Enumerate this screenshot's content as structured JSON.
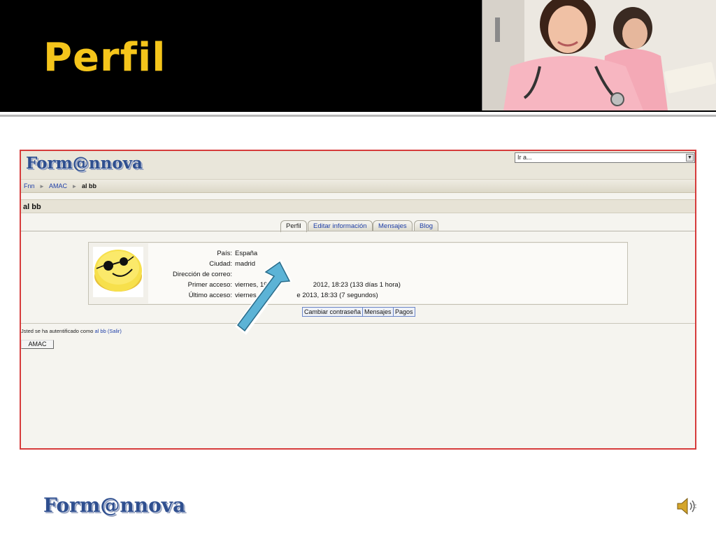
{
  "slide": {
    "title": "Perfil",
    "footer_logo": "Form@nnova"
  },
  "header_photo": {
    "icon": "nurses-photo"
  },
  "app": {
    "logo": "Form@nnova",
    "jump_select": {
      "value": "Ir a...",
      "icon": "dropdown-arrow-icon"
    },
    "breadcrumb": {
      "items": [
        "Fnn",
        "AMAC",
        "al bb"
      ],
      "separator": "►"
    },
    "user_title": "al bb",
    "tabs": [
      {
        "label": "Perfil",
        "active": true
      },
      {
        "label": "Editar información",
        "active": false
      },
      {
        "label": "Mensajes",
        "active": false
      },
      {
        "label": "Blog",
        "active": false
      }
    ],
    "profile": {
      "avatar": "smiley-face-image",
      "fields": [
        {
          "label": "País:",
          "value": "España"
        },
        {
          "label": "Ciudad:",
          "value": "madrid"
        },
        {
          "label": "Dirección de correo:",
          "value": ""
        },
        {
          "label": "Primer acceso:",
          "value": "viernes, 19 de",
          "value_tail": "2012, 18:23  (133 días 1 hora)"
        },
        {
          "label": "Último acceso:",
          "value": "viernes, 1 de",
          "value_tail": "e 2013, 18:33  (7 segundos)"
        }
      ]
    },
    "actions": [
      "Cambiar contraseña",
      "Mensajes",
      "Pagos"
    ],
    "auth": {
      "prefix": "Jsted se ha autentificado como",
      "user": "al bb",
      "logout": "(Salir)"
    },
    "course_button": "AMAC"
  },
  "icons": {
    "arrow": "pointer-arrow-icon",
    "speaker": "speaker-icon"
  },
  "colors": {
    "title": "#f5c51b",
    "header_bg": "#000000",
    "screenshot_border": "#d63b3b",
    "link": "#1f3fa8",
    "arrow": "#5cb3d6"
  }
}
